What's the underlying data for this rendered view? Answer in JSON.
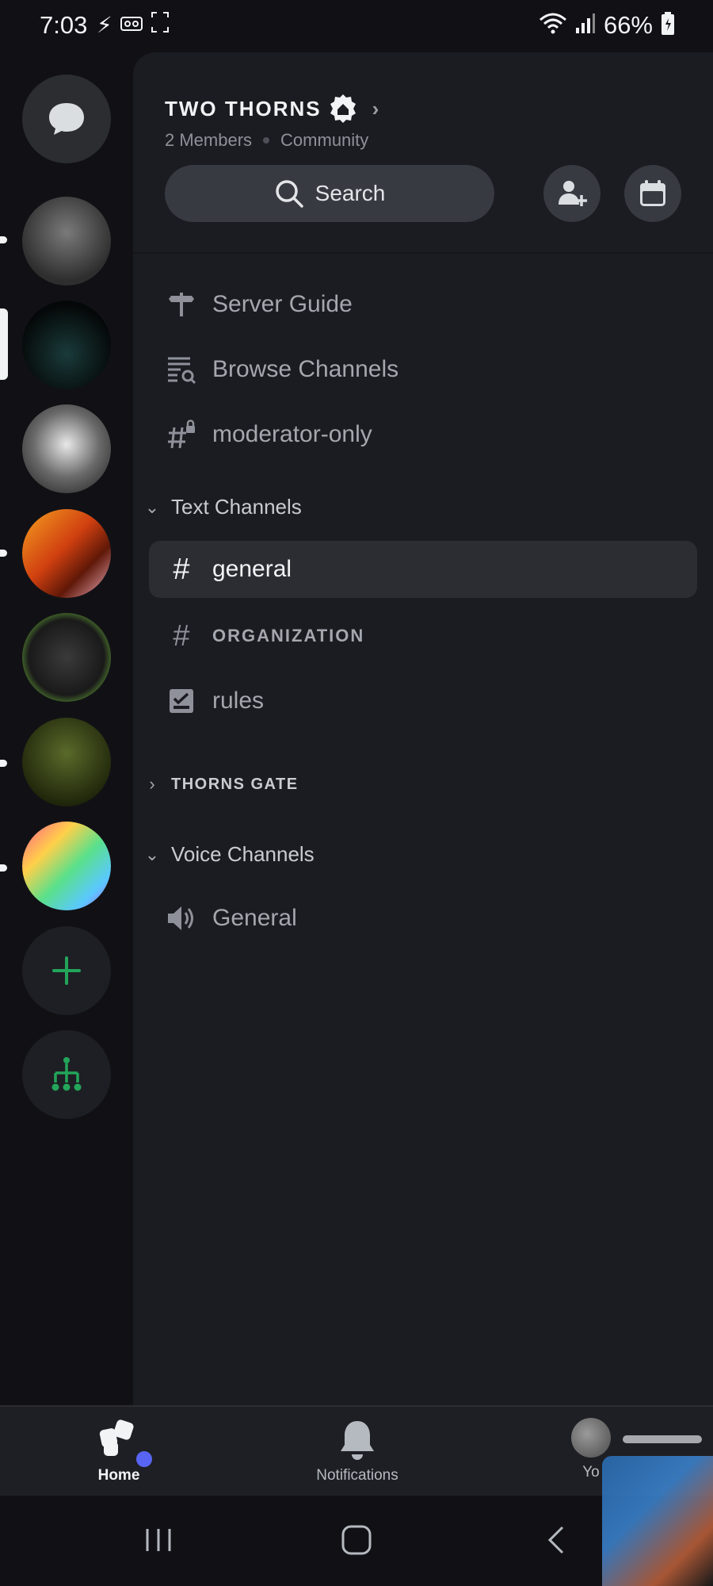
{
  "status_bar": {
    "time": "7:03",
    "battery": "66%"
  },
  "server_rail": {
    "servers": [
      {
        "name": "dm-button",
        "kind": "direct-messages"
      },
      {
        "name": "server-1",
        "colors": [
          "#6a6a6a",
          "#3a3a3a"
        ],
        "has_unread": true
      },
      {
        "name": "server-2",
        "colors": [
          "#0f2a2a",
          "#050808"
        ],
        "selected": true
      },
      {
        "name": "server-3",
        "colors": [
          "#d8d8d8",
          "#5a5a5a"
        ]
      },
      {
        "name": "server-4",
        "colors": [
          "#f08a1a",
          "#6a1808"
        ],
        "has_unread": true
      },
      {
        "name": "server-5",
        "colors": [
          "#2a2a2a",
          "#8be04a"
        ]
      },
      {
        "name": "server-6",
        "colors": [
          "#3a4a1a",
          "#1a2008"
        ],
        "has_unread": true
      },
      {
        "name": "server-7",
        "colors": [
          "#ff5a8a",
          "#5ac8ff"
        ],
        "has_unread": true
      }
    ],
    "add_server_icon": "plus-icon",
    "discover_icon": "hub-icon",
    "accent_green": "#23a55a"
  },
  "guild": {
    "name": "TWO THORNS",
    "members": "2 Members",
    "type": "Community",
    "search_label": "Search"
  },
  "channels": {
    "top_items": [
      {
        "label": "Server Guide",
        "icon": "signpost-icon"
      },
      {
        "label": "Browse Channels",
        "icon": "browse-channels-icon"
      },
      {
        "label": "moderator-only",
        "icon": "locked-hash-icon"
      }
    ],
    "categories": [
      {
        "label": "Text Channels",
        "expanded": true,
        "channels": [
          {
            "label": "general",
            "icon": "hash-icon",
            "active": true
          },
          {
            "label": "ORGANIZATION",
            "icon": "hash-icon"
          },
          {
            "label": "rules",
            "icon": "rules-icon"
          }
        ]
      },
      {
        "label": "THORNS GATE",
        "expanded": false,
        "channels": []
      },
      {
        "label": "Voice Channels",
        "expanded": true,
        "channels": [
          {
            "label": "General",
            "icon": "speaker-icon"
          }
        ]
      }
    ]
  },
  "tabs": {
    "home": "Home",
    "notifications": "Notifications",
    "you": "Yo"
  },
  "colors": {
    "background": "#111115",
    "panel": "#1b1c22",
    "active_row": "#2b2d33",
    "blurple": "#5865f2"
  }
}
